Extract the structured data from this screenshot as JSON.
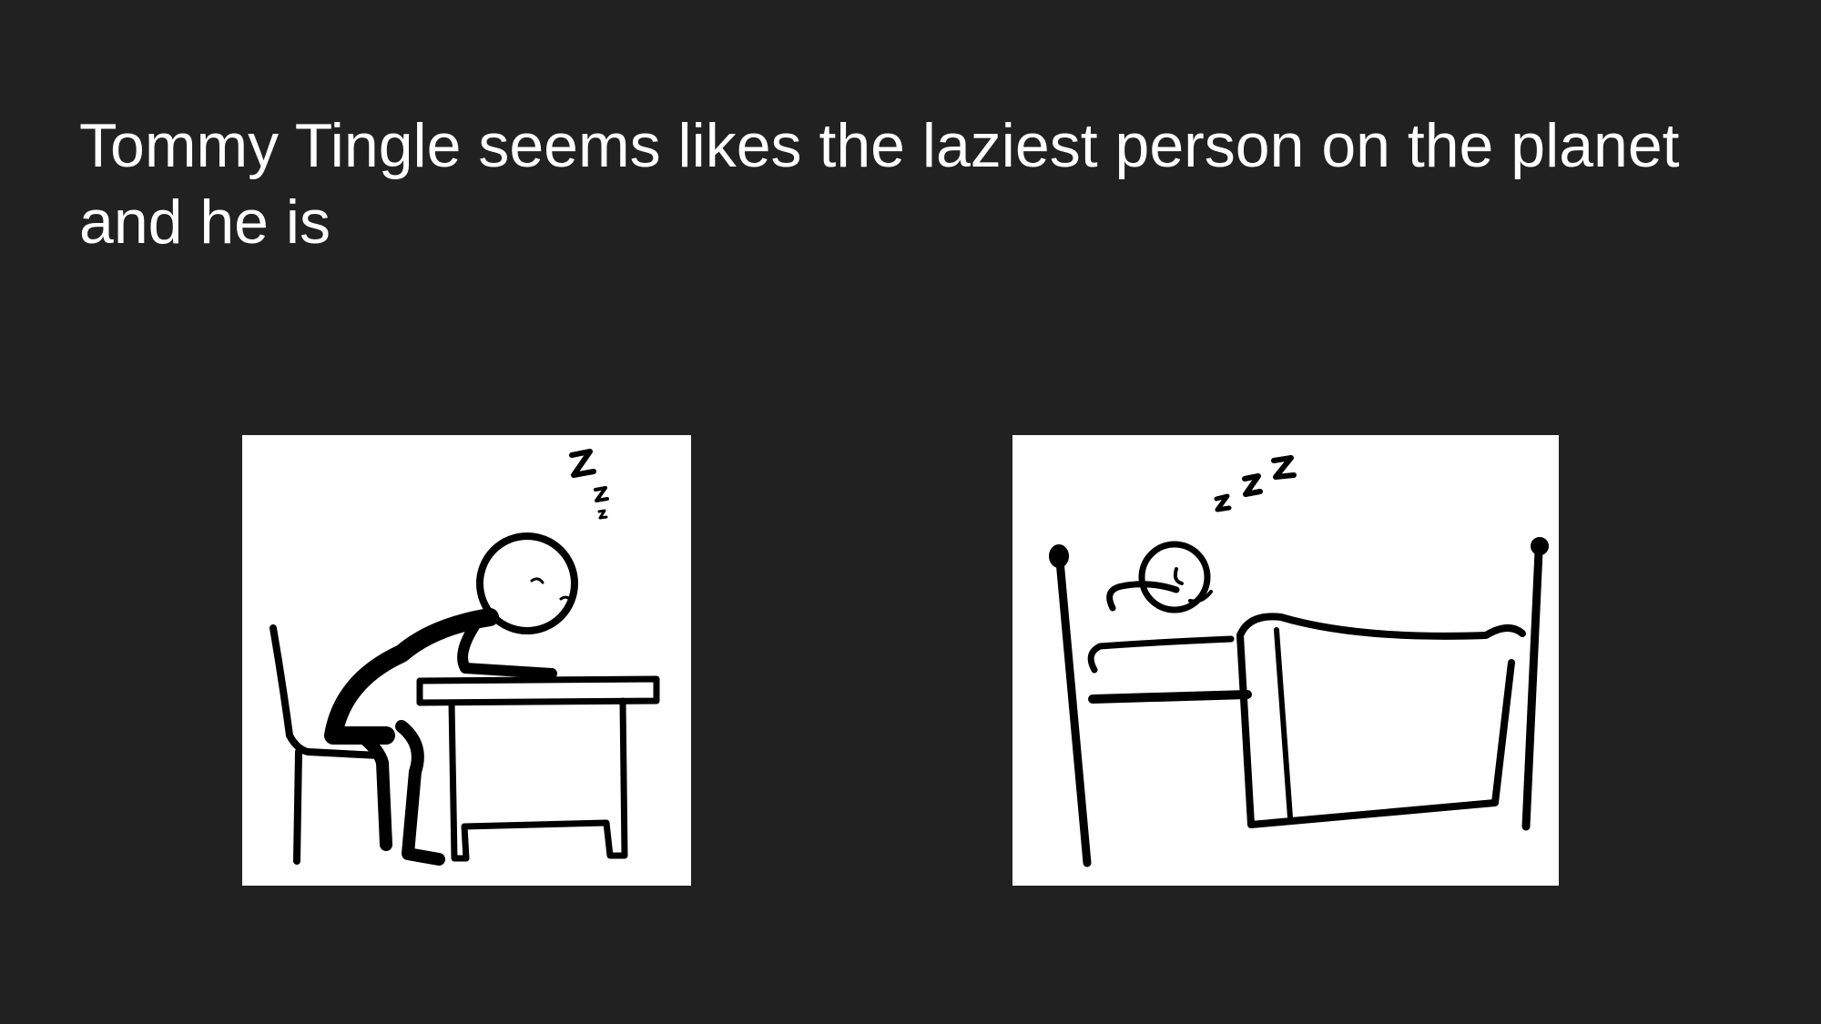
{
  "slide": {
    "title": "Tommy Tingle seems likes the laziest person on the planet and he is",
    "background_color": "#212121",
    "text_color": "#ffffff"
  },
  "images": [
    {
      "name": "sleeping-at-desk-illustration",
      "icon": "stick-figure-asleep-at-desk"
    },
    {
      "name": "sleeping-in-bed-illustration",
      "icon": "stick-figure-asleep-in-bed"
    }
  ]
}
